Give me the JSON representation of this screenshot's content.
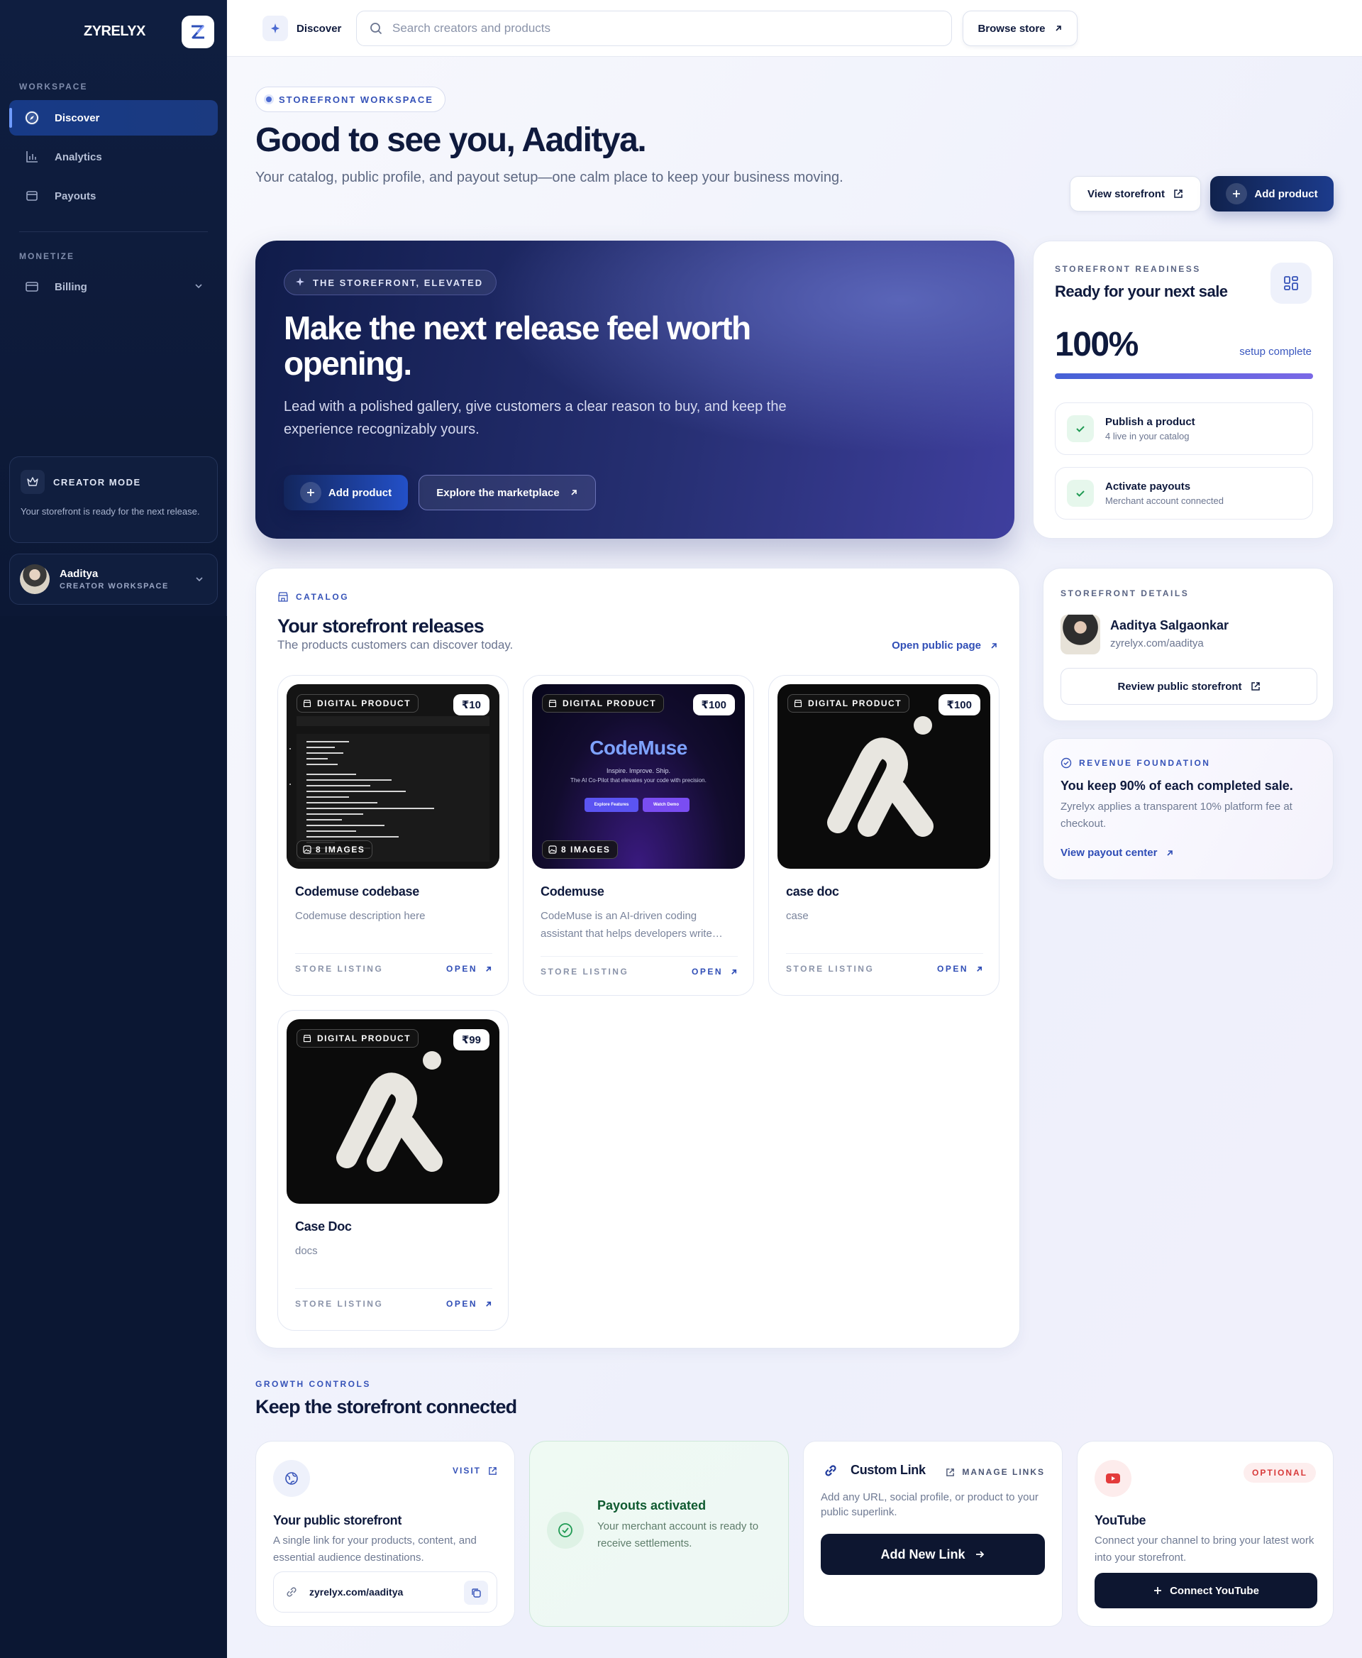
{
  "sidebar": {
    "brand": "ZYRELYX",
    "section_workspace": "WORKSPACE",
    "items": [
      {
        "label": "Discover"
      },
      {
        "label": "Analytics"
      },
      {
        "label": "Payouts"
      }
    ],
    "section_monetize": "MONETIZE",
    "billing_label": "Billing",
    "creator_mode": {
      "title": "CREATOR MODE",
      "text": "Your storefront is ready for the next release."
    },
    "user": {
      "name": "Aaditya",
      "sub": "CREATOR WORKSPACE"
    }
  },
  "topbar": {
    "discover_label": "Discover",
    "search_placeholder": "Search creators and products",
    "browse_label": "Browse store"
  },
  "header": {
    "pill": "STOREFRONT WORKSPACE",
    "title": "Good to see you, Aaditya.",
    "subtitle": "Your catalog, public profile, and payout setup—one calm place to keep your business moving.",
    "view_storefront": "View storefront",
    "add_product": "Add product"
  },
  "hero": {
    "pill": "THE STOREFRONT, ELEVATED",
    "title": "Make the next release feel worth opening.",
    "text": "Lead with a polished gallery, give customers a clear reason to buy, and keep the experience recognizably yours.",
    "primary": "Add product",
    "secondary": "Explore the marketplace"
  },
  "readiness": {
    "eyebrow": "STOREFRONT READINESS",
    "title": "Ready for your next sale",
    "percent_label": "100%",
    "percent_value": 100,
    "setup_label": "setup complete",
    "checks": [
      {
        "title": "Publish a product",
        "sub": "4 live in your catalog"
      },
      {
        "title": "Activate payouts",
        "sub": "Merchant account connected"
      }
    ]
  },
  "catalog": {
    "eyebrow": "CATALOG",
    "title": "Your storefront releases",
    "subtitle": "The products customers can discover today.",
    "open_public": "Open public page",
    "products": [
      {
        "tag": "DIGITAL PRODUCT",
        "price": "₹10",
        "images": "8 IMAGES",
        "name": "Codemuse codebase",
        "desc": "Codemuse description here",
        "foot_left": "STORE LISTING",
        "foot_right": "OPEN"
      },
      {
        "tag": "DIGITAL PRODUCT",
        "price": "₹100",
        "images": "8 IMAGES",
        "name": "Codemuse",
        "desc": "CodeMuse is an AI-driven coding assistant that helps developers write…",
        "foot_left": "STORE LISTING",
        "foot_right": "OPEN",
        "img_title": "CodeMuse",
        "img_tag": "Inspire. Improve. Ship.",
        "img_line": "The AI Co-Pilot that elevates your code with precision.",
        "img_btn1": "Explore Features",
        "img_btn2": "Watch Demo"
      },
      {
        "tag": "DIGITAL PRODUCT",
        "price": "₹100",
        "name": "case doc",
        "desc": "case",
        "foot_left": "STORE LISTING",
        "foot_right": "OPEN"
      },
      {
        "tag": "DIGITAL PRODUCT",
        "price": "₹99",
        "name": "Case Doc",
        "desc": "docs",
        "foot_left": "STORE LISTING",
        "foot_right": "OPEN"
      }
    ]
  },
  "details": {
    "eyebrow": "STOREFRONT DETAILS",
    "name": "Aaditya Salgaonkar",
    "url": "zyrelyx.com/aaditya",
    "review": "Review public storefront"
  },
  "revenue": {
    "eyebrow": "REVENUE FOUNDATION",
    "title": "You keep 90% of each completed sale.",
    "text": "Zyrelyx applies a transparent 10% platform fee at checkout.",
    "link": "View payout center"
  },
  "growth": {
    "eyebrow": "GROWTH CONTROLS",
    "title": "Keep the storefront connected",
    "public": {
      "visit": "VISIT",
      "title": "Your public storefront",
      "text": "A single link for your products, content, and essential audience destinations.",
      "url": "zyrelyx.com/aaditya"
    },
    "payouts": {
      "title": "Payouts activated",
      "text": "Your merchant account is ready to receive settlements."
    },
    "custom": {
      "title": "Custom Link",
      "manage": "MANAGE LINKS",
      "text": "Add any URL, social profile, or product to your public superlink.",
      "button": "Add New Link"
    },
    "youtube": {
      "tag": "OPTIONAL",
      "title": "YouTube",
      "text": "Connect your channel to bring your latest work into your storefront.",
      "button": "Connect YouTube"
    }
  },
  "colors": {
    "sidebar": "#0b1733",
    "accent": "#3552b8",
    "hero": "#262f72",
    "success": "#1f9a53",
    "youtube": "#e33b3b"
  }
}
